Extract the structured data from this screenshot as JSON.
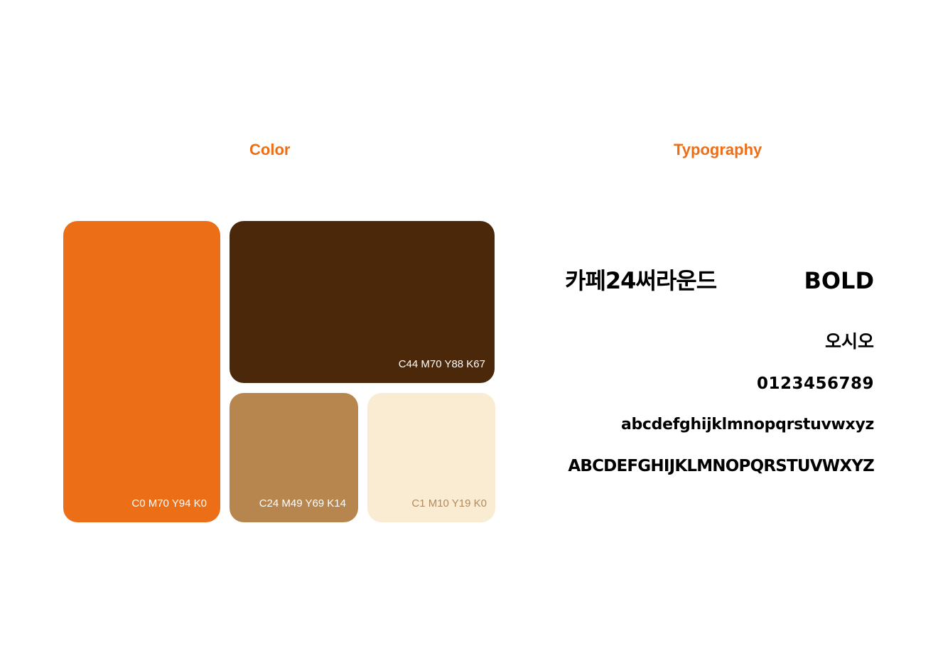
{
  "sections": {
    "color_title": "Color",
    "typography_title": "Typography"
  },
  "swatches": [
    {
      "code": "C0 M70 Y94 K0",
      "hex": "#EC6E17"
    },
    {
      "code": "C44 M70 Y88 K67",
      "hex": "#4B280A"
    },
    {
      "code": "C24 M49 Y69 K14",
      "hex": "#B7864F"
    },
    {
      "code": "C1 M10 Y19 K0",
      "hex": "#FAEBD3"
    }
  ],
  "typography": {
    "font_name": "카페24써라운드",
    "weight": "BOLD",
    "sample_korean": "오시오",
    "sample_digits": "0123456789",
    "sample_lowercase": "abcdefghijklmnopqrstuvwxyz",
    "sample_uppercase": "ABCDEFGHIJKLMNOPQRSTUVWXYZ"
  },
  "colors": {
    "accent": "#EC6E17",
    "text": "#000000",
    "background": "#FFFFFF"
  }
}
